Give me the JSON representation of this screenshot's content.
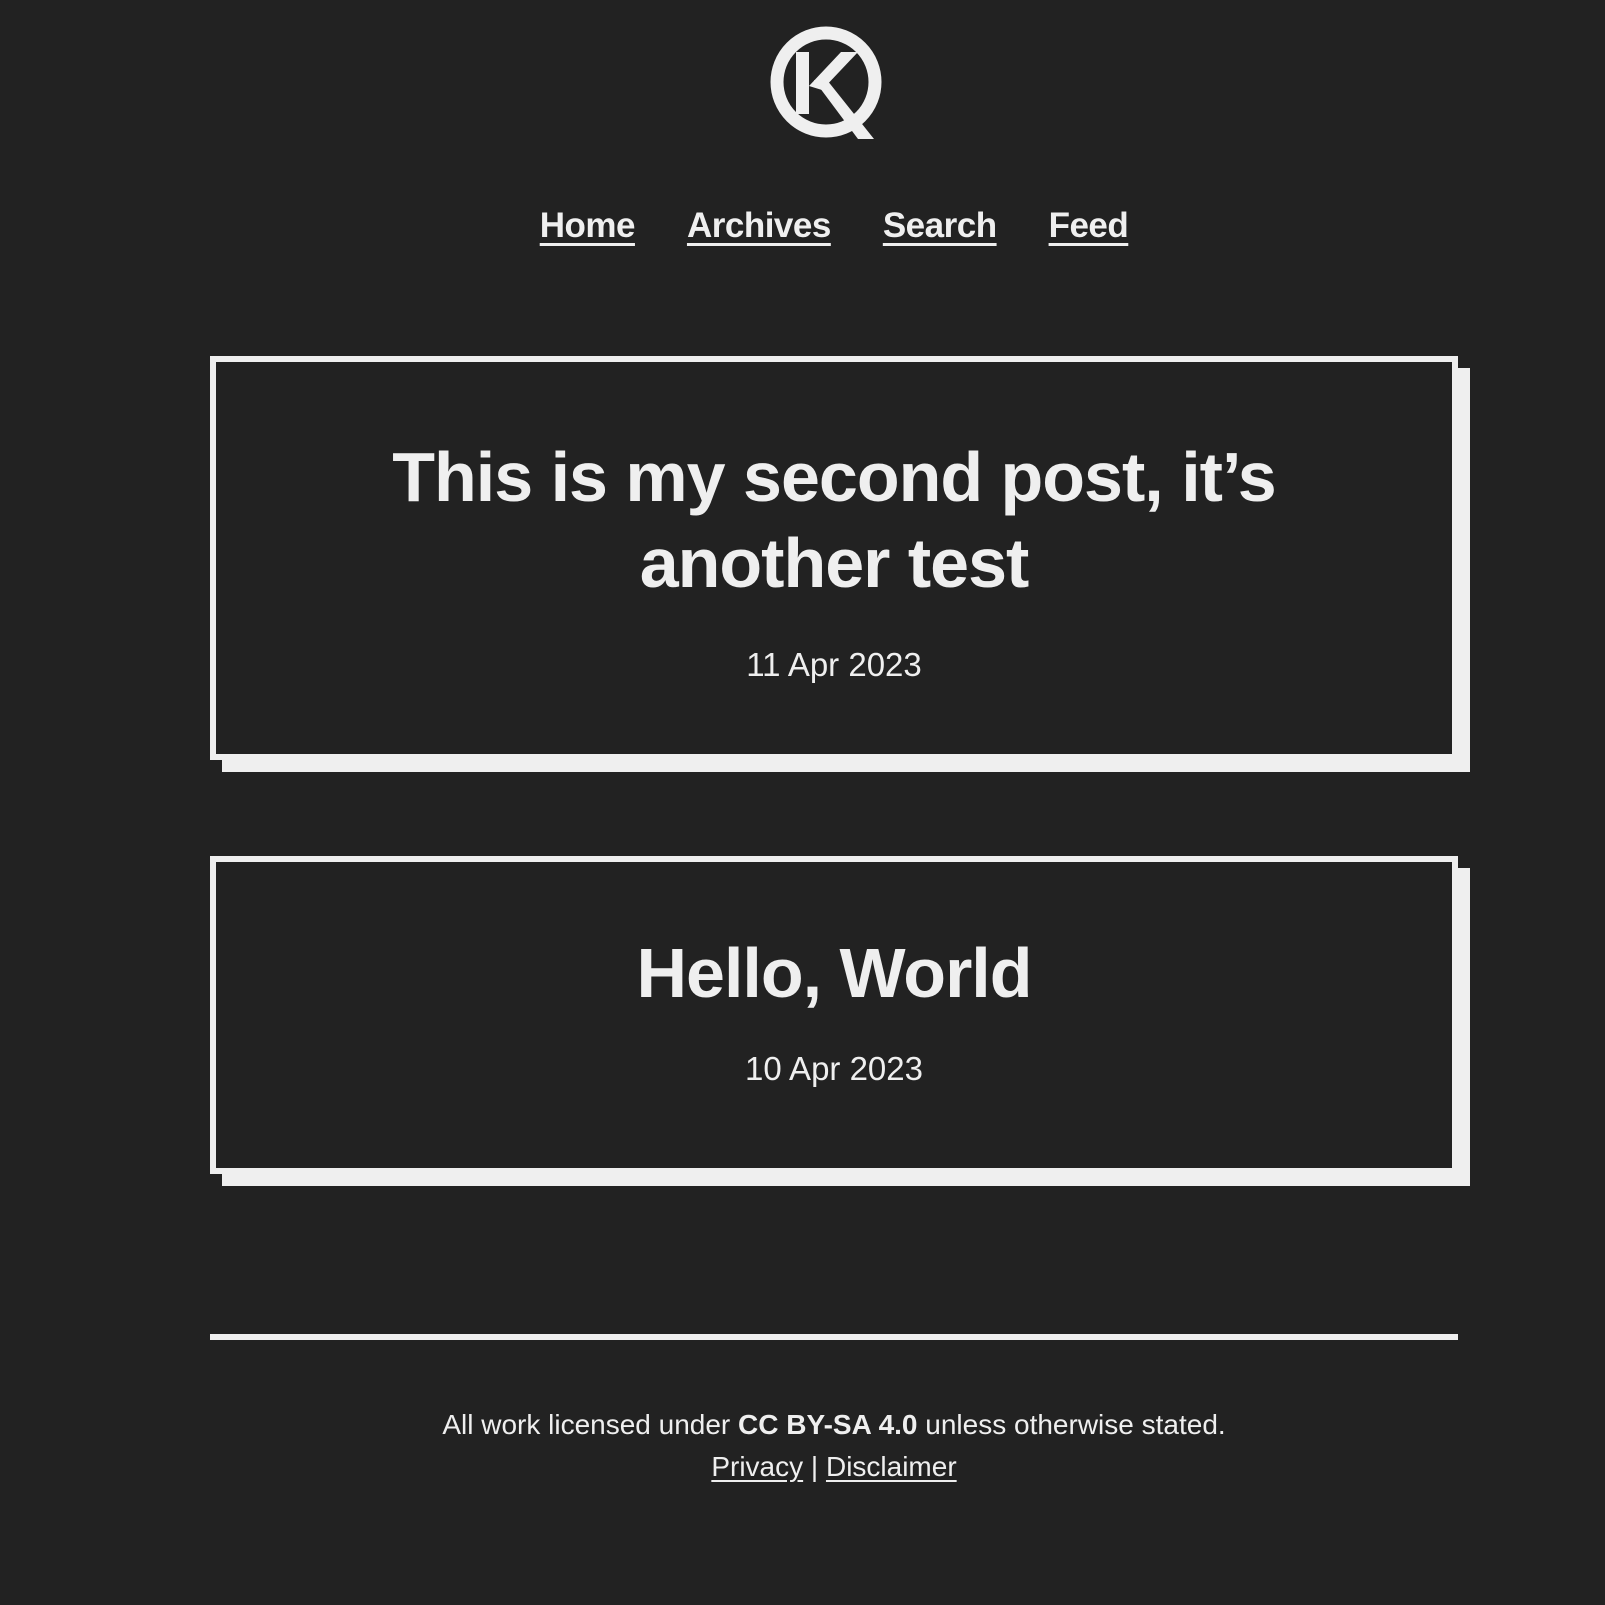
{
  "site": {
    "logo_letter": "K",
    "logo_color": "#efefef",
    "background_color": "#222222"
  },
  "nav": {
    "items": [
      {
        "label": "Home"
      },
      {
        "label": "Archives"
      },
      {
        "label": "Search"
      },
      {
        "label": "Feed"
      }
    ]
  },
  "posts": [
    {
      "title": "This is my second post, it’s another test",
      "date": "11 Apr 2023"
    },
    {
      "title": "Hello, World",
      "date": "10 Apr 2023"
    }
  ],
  "footer": {
    "license_prefix": "All work licensed under ",
    "license_name": "CC BY-SA 4.0",
    "license_suffix": " unless otherwise stated.",
    "privacy_label": "Privacy",
    "separator": " | ",
    "disclaimer_label": "Disclaimer"
  }
}
